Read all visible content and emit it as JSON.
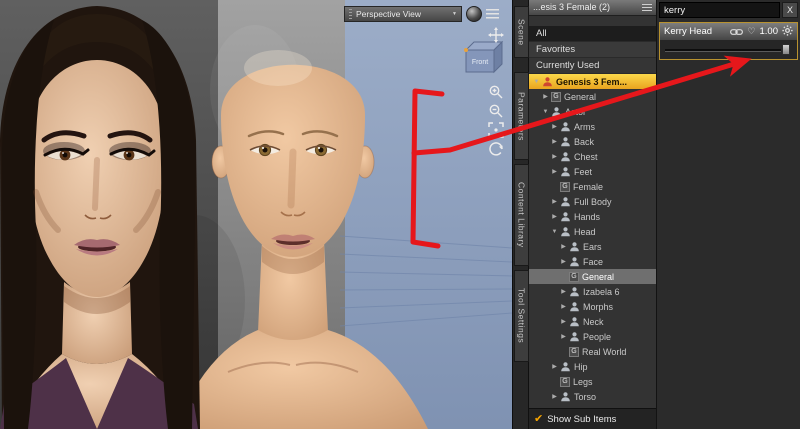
{
  "viewport": {
    "view_label": "Perspective View",
    "cube_face_label": "Front"
  },
  "side_tabs": [
    {
      "label": "Scene"
    },
    {
      "label": "Parameters"
    },
    {
      "label": "Content Library"
    },
    {
      "label": "Tool Settings"
    }
  ],
  "parameters_panel": {
    "header_title": "...esis 3 Female (2)",
    "filters": [
      {
        "label": "All"
      },
      {
        "label": "Favorites"
      },
      {
        "label": "Currently Used"
      }
    ],
    "tree": [
      {
        "label": "Genesis 3 Fem...",
        "depth": 0,
        "icon": "figure",
        "expander": "down",
        "state": "selected-yellow"
      },
      {
        "label": "General",
        "depth": 1,
        "icon": "g",
        "expander": "right"
      },
      {
        "label": "Actor",
        "depth": 1,
        "icon": "person",
        "expander": "down"
      },
      {
        "label": "Arms",
        "depth": 2,
        "icon": "person",
        "expander": "right"
      },
      {
        "label": "Back",
        "depth": 2,
        "icon": "person",
        "expander": "right"
      },
      {
        "label": "Chest",
        "depth": 2,
        "icon": "person",
        "expander": "right"
      },
      {
        "label": "Feet",
        "depth": 2,
        "icon": "person",
        "expander": "right"
      },
      {
        "label": "Female",
        "depth": 2,
        "icon": "g",
        "expander": "none"
      },
      {
        "label": "Full Body",
        "depth": 2,
        "icon": "person",
        "expander": "right"
      },
      {
        "label": "Hands",
        "depth": 2,
        "icon": "person",
        "expander": "right"
      },
      {
        "label": "Head",
        "depth": 2,
        "icon": "person",
        "expander": "down"
      },
      {
        "label": "Ears",
        "depth": 3,
        "icon": "person",
        "expander": "right"
      },
      {
        "label": "Face",
        "depth": 3,
        "icon": "person",
        "expander": "right"
      },
      {
        "label": "General",
        "depth": 3,
        "icon": "g",
        "expander": "none",
        "state": "selected-gray"
      },
      {
        "label": "Izabela 6",
        "depth": 3,
        "icon": "person",
        "expander": "right"
      },
      {
        "label": "Morphs",
        "depth": 3,
        "icon": "person",
        "expander": "right"
      },
      {
        "label": "Neck",
        "depth": 3,
        "icon": "person",
        "expander": "right"
      },
      {
        "label": "People",
        "depth": 3,
        "icon": "person",
        "expander": "right"
      },
      {
        "label": "Real World",
        "depth": 3,
        "icon": "g",
        "expander": "none"
      },
      {
        "label": "Hip",
        "depth": 2,
        "icon": "person",
        "expander": "right"
      },
      {
        "label": "Legs",
        "depth": 2,
        "icon": "g",
        "expander": "none"
      },
      {
        "label": "Torso",
        "depth": 2,
        "icon": "person",
        "expander": "right"
      }
    ],
    "footer_checkbox_label": "Show Sub Items",
    "footer_checkbox_checked": true
  },
  "search_panel": {
    "query": "kerry",
    "close_label": "X",
    "parameter_name": "Kerry Head",
    "parameter_value": "1.00"
  },
  "colors": {
    "selection_yellow": "#f2c12e",
    "annotation_red": "#e6171b",
    "viewport_blue": "#8c9dbb"
  }
}
